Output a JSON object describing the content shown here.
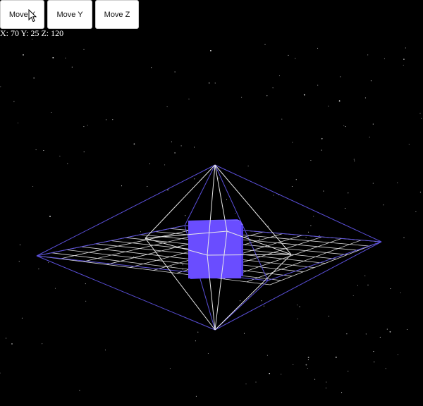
{
  "controls": {
    "move_x_label": "Move X",
    "move_y_label": "Move Y",
    "move_z_label": "Move Z"
  },
  "position_readout": "X: 70 Y: 25 Z: 120",
  "position": {
    "x": 70,
    "y": 25,
    "z": 120
  },
  "scene": {
    "background_color": "#000000",
    "star_color": "#ffffff",
    "grid_color": "#d8d8d8",
    "octahedron_outer_color": "#5a4fd9",
    "octahedron_inner_color": "#e8e8e8",
    "cube_color": "#6a4dff"
  },
  "icons": {
    "cursor": "mouse-pointer-icon"
  }
}
